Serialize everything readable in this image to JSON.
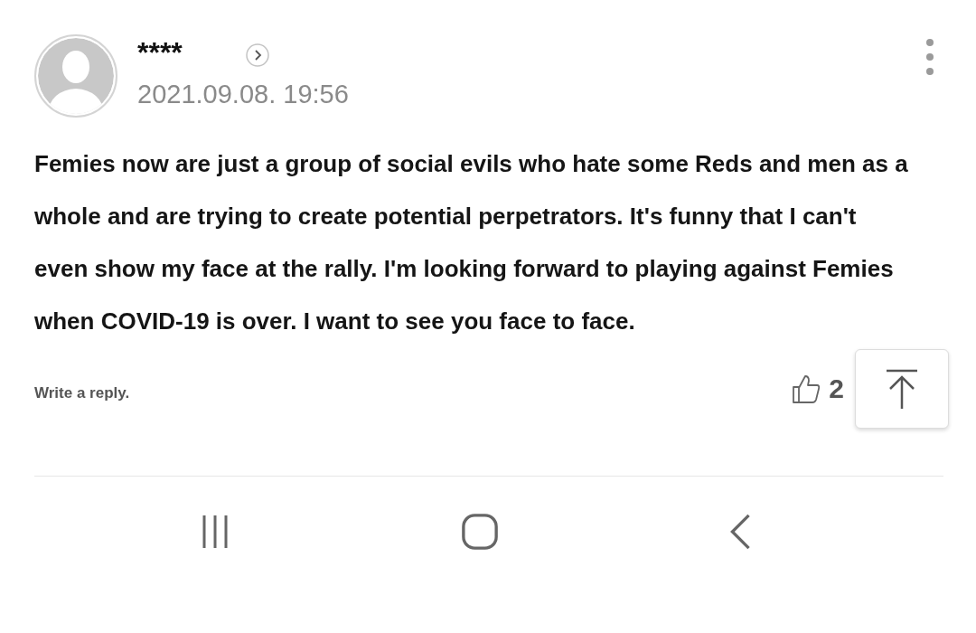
{
  "comment": {
    "author": "****",
    "date": "2021.09.08. 19:56",
    "text": "Femies now are just a group of social evils who hate some Reds and men as a whole and are trying to create potential perpetrators. It's funny that I can't even show my face at the rally. I'm looking forward to playing against Femies when COVID-19 is over. I want to see you face to face.",
    "reply_link": "Write a reply.",
    "like_count": "2"
  }
}
